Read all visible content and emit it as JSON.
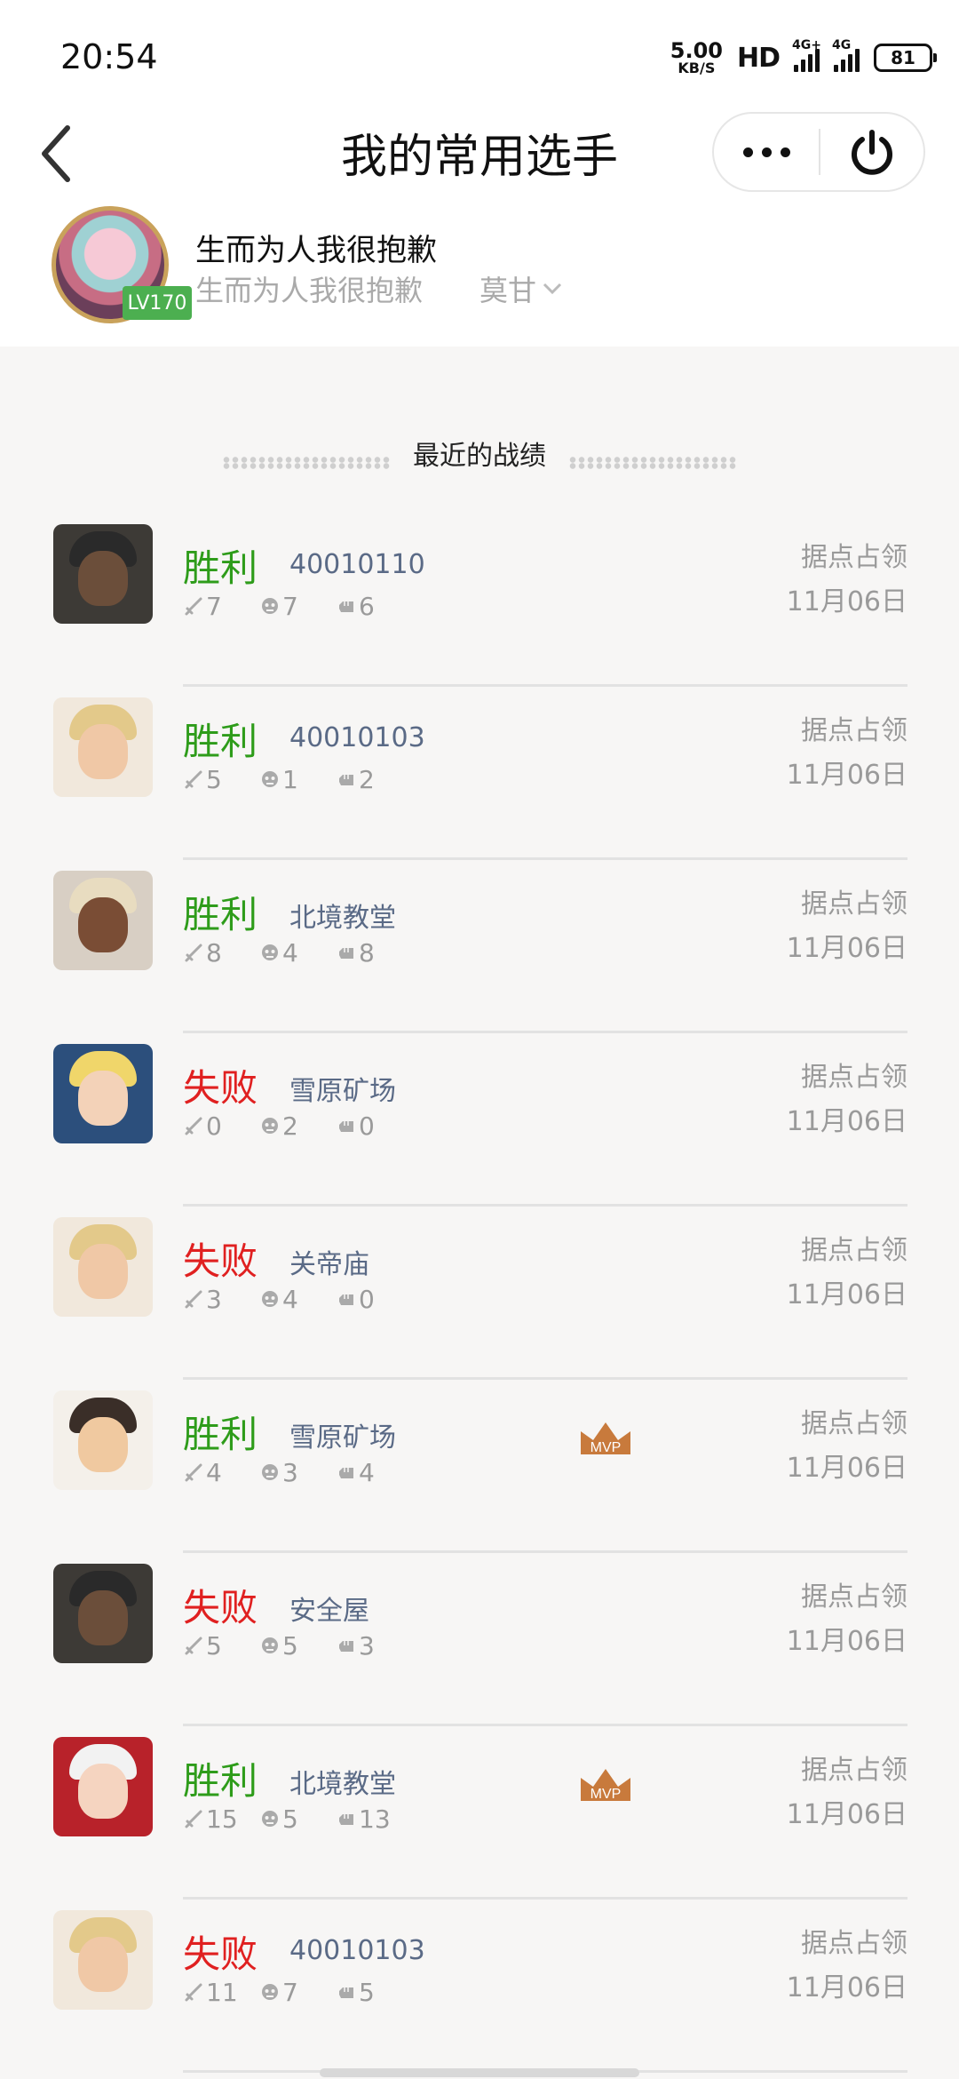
{
  "status_bar": {
    "time": "20:54",
    "net_speed_value": "5.00",
    "net_speed_unit": "KB/S",
    "hd": "HD",
    "signal1_label": "4G+",
    "signal2_label": "4G",
    "battery": "81"
  },
  "nav": {
    "title": "我的常用选手"
  },
  "profile": {
    "level": "LV170",
    "name": "生而为人我很抱歉",
    "sub_name": "生而为人我很抱歉",
    "server": "莫甘"
  },
  "section": {
    "title": "最近的战绩"
  },
  "colors": {
    "win": "#2e9c1a",
    "lose": "#e02020",
    "map_text": "#5a6a86",
    "level_badge": "#4caf50",
    "mvp": "#c87a3c"
  },
  "records": [
    {
      "result": "胜利",
      "outcome": "win",
      "map": "40010110",
      "kills": "7",
      "deaths": "7",
      "assists": "6",
      "mode": "据点占领",
      "date": "11月06日",
      "mvp": false
    },
    {
      "result": "胜利",
      "outcome": "win",
      "map": "40010103",
      "kills": "5",
      "deaths": "1",
      "assists": "2",
      "mode": "据点占领",
      "date": "11月06日",
      "mvp": false
    },
    {
      "result": "胜利",
      "outcome": "win",
      "map": "北境教堂",
      "kills": "8",
      "deaths": "4",
      "assists": "8",
      "mode": "据点占领",
      "date": "11月06日",
      "mvp": false
    },
    {
      "result": "失败",
      "outcome": "lose",
      "map": "雪原矿场",
      "kills": "0",
      "deaths": "2",
      "assists": "0",
      "mode": "据点占领",
      "date": "11月06日",
      "mvp": false
    },
    {
      "result": "失败",
      "outcome": "lose",
      "map": "关帝庙",
      "kills": "3",
      "deaths": "4",
      "assists": "0",
      "mode": "据点占领",
      "date": "11月06日",
      "mvp": false
    },
    {
      "result": "胜利",
      "outcome": "win",
      "map": "雪原矿场",
      "kills": "4",
      "deaths": "3",
      "assists": "4",
      "mode": "据点占领",
      "date": "11月06日",
      "mvp": true
    },
    {
      "result": "失败",
      "outcome": "lose",
      "map": "安全屋",
      "kills": "5",
      "deaths": "5",
      "assists": "3",
      "mode": "据点占领",
      "date": "11月06日",
      "mvp": false
    },
    {
      "result": "胜利",
      "outcome": "win",
      "map": "北境教堂",
      "kills": "15",
      "deaths": "5",
      "assists": "13",
      "mode": "据点占领",
      "date": "11月06日",
      "mvp": true
    },
    {
      "result": "失败",
      "outcome": "lose",
      "map": "40010103",
      "kills": "11",
      "deaths": "7",
      "assists": "5",
      "mode": "据点占领",
      "date": "11月06日",
      "mvp": false
    }
  ],
  "mvp_label": "MVP",
  "icons": {
    "back": "chevron-left-icon",
    "more": "more-dots-icon",
    "close": "power-icon",
    "kills": "sword-icon",
    "deaths": "skull-icon",
    "assists": "fist-icon",
    "server_dropdown": "chevron-down-icon",
    "mvp": "crown-icon"
  }
}
